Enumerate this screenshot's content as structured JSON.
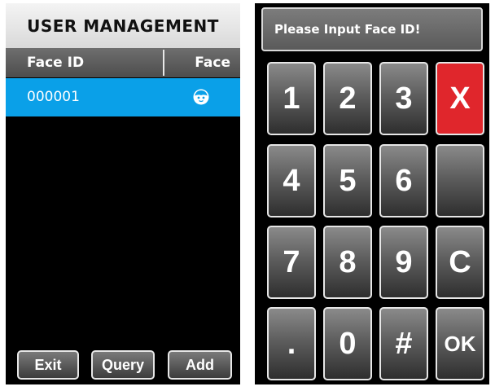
{
  "left": {
    "title": "USER MANAGEMENT",
    "columns": {
      "id": "Face ID",
      "face": "Face"
    },
    "rows": [
      {
        "id": "000001",
        "face_icon": "face-icon"
      }
    ],
    "buttons": {
      "exit": "Exit",
      "query": "Query",
      "add": "Add"
    },
    "colors": {
      "selected_row": "#0aa0e8"
    }
  },
  "right": {
    "prompt": "Please Input Face ID!",
    "keys": {
      "k1": "1",
      "k2": "2",
      "k3": "3",
      "kx": "X",
      "k4": "4",
      "k5": "5",
      "k6": "6",
      "kblank": "",
      "k7": "7",
      "k8": "8",
      "k9": "9",
      "kc": "C",
      "kdot": ".",
      "k0": "0",
      "khash": "#",
      "kok": "OK"
    },
    "colors": {
      "delete_key": "#e0262c"
    }
  }
}
